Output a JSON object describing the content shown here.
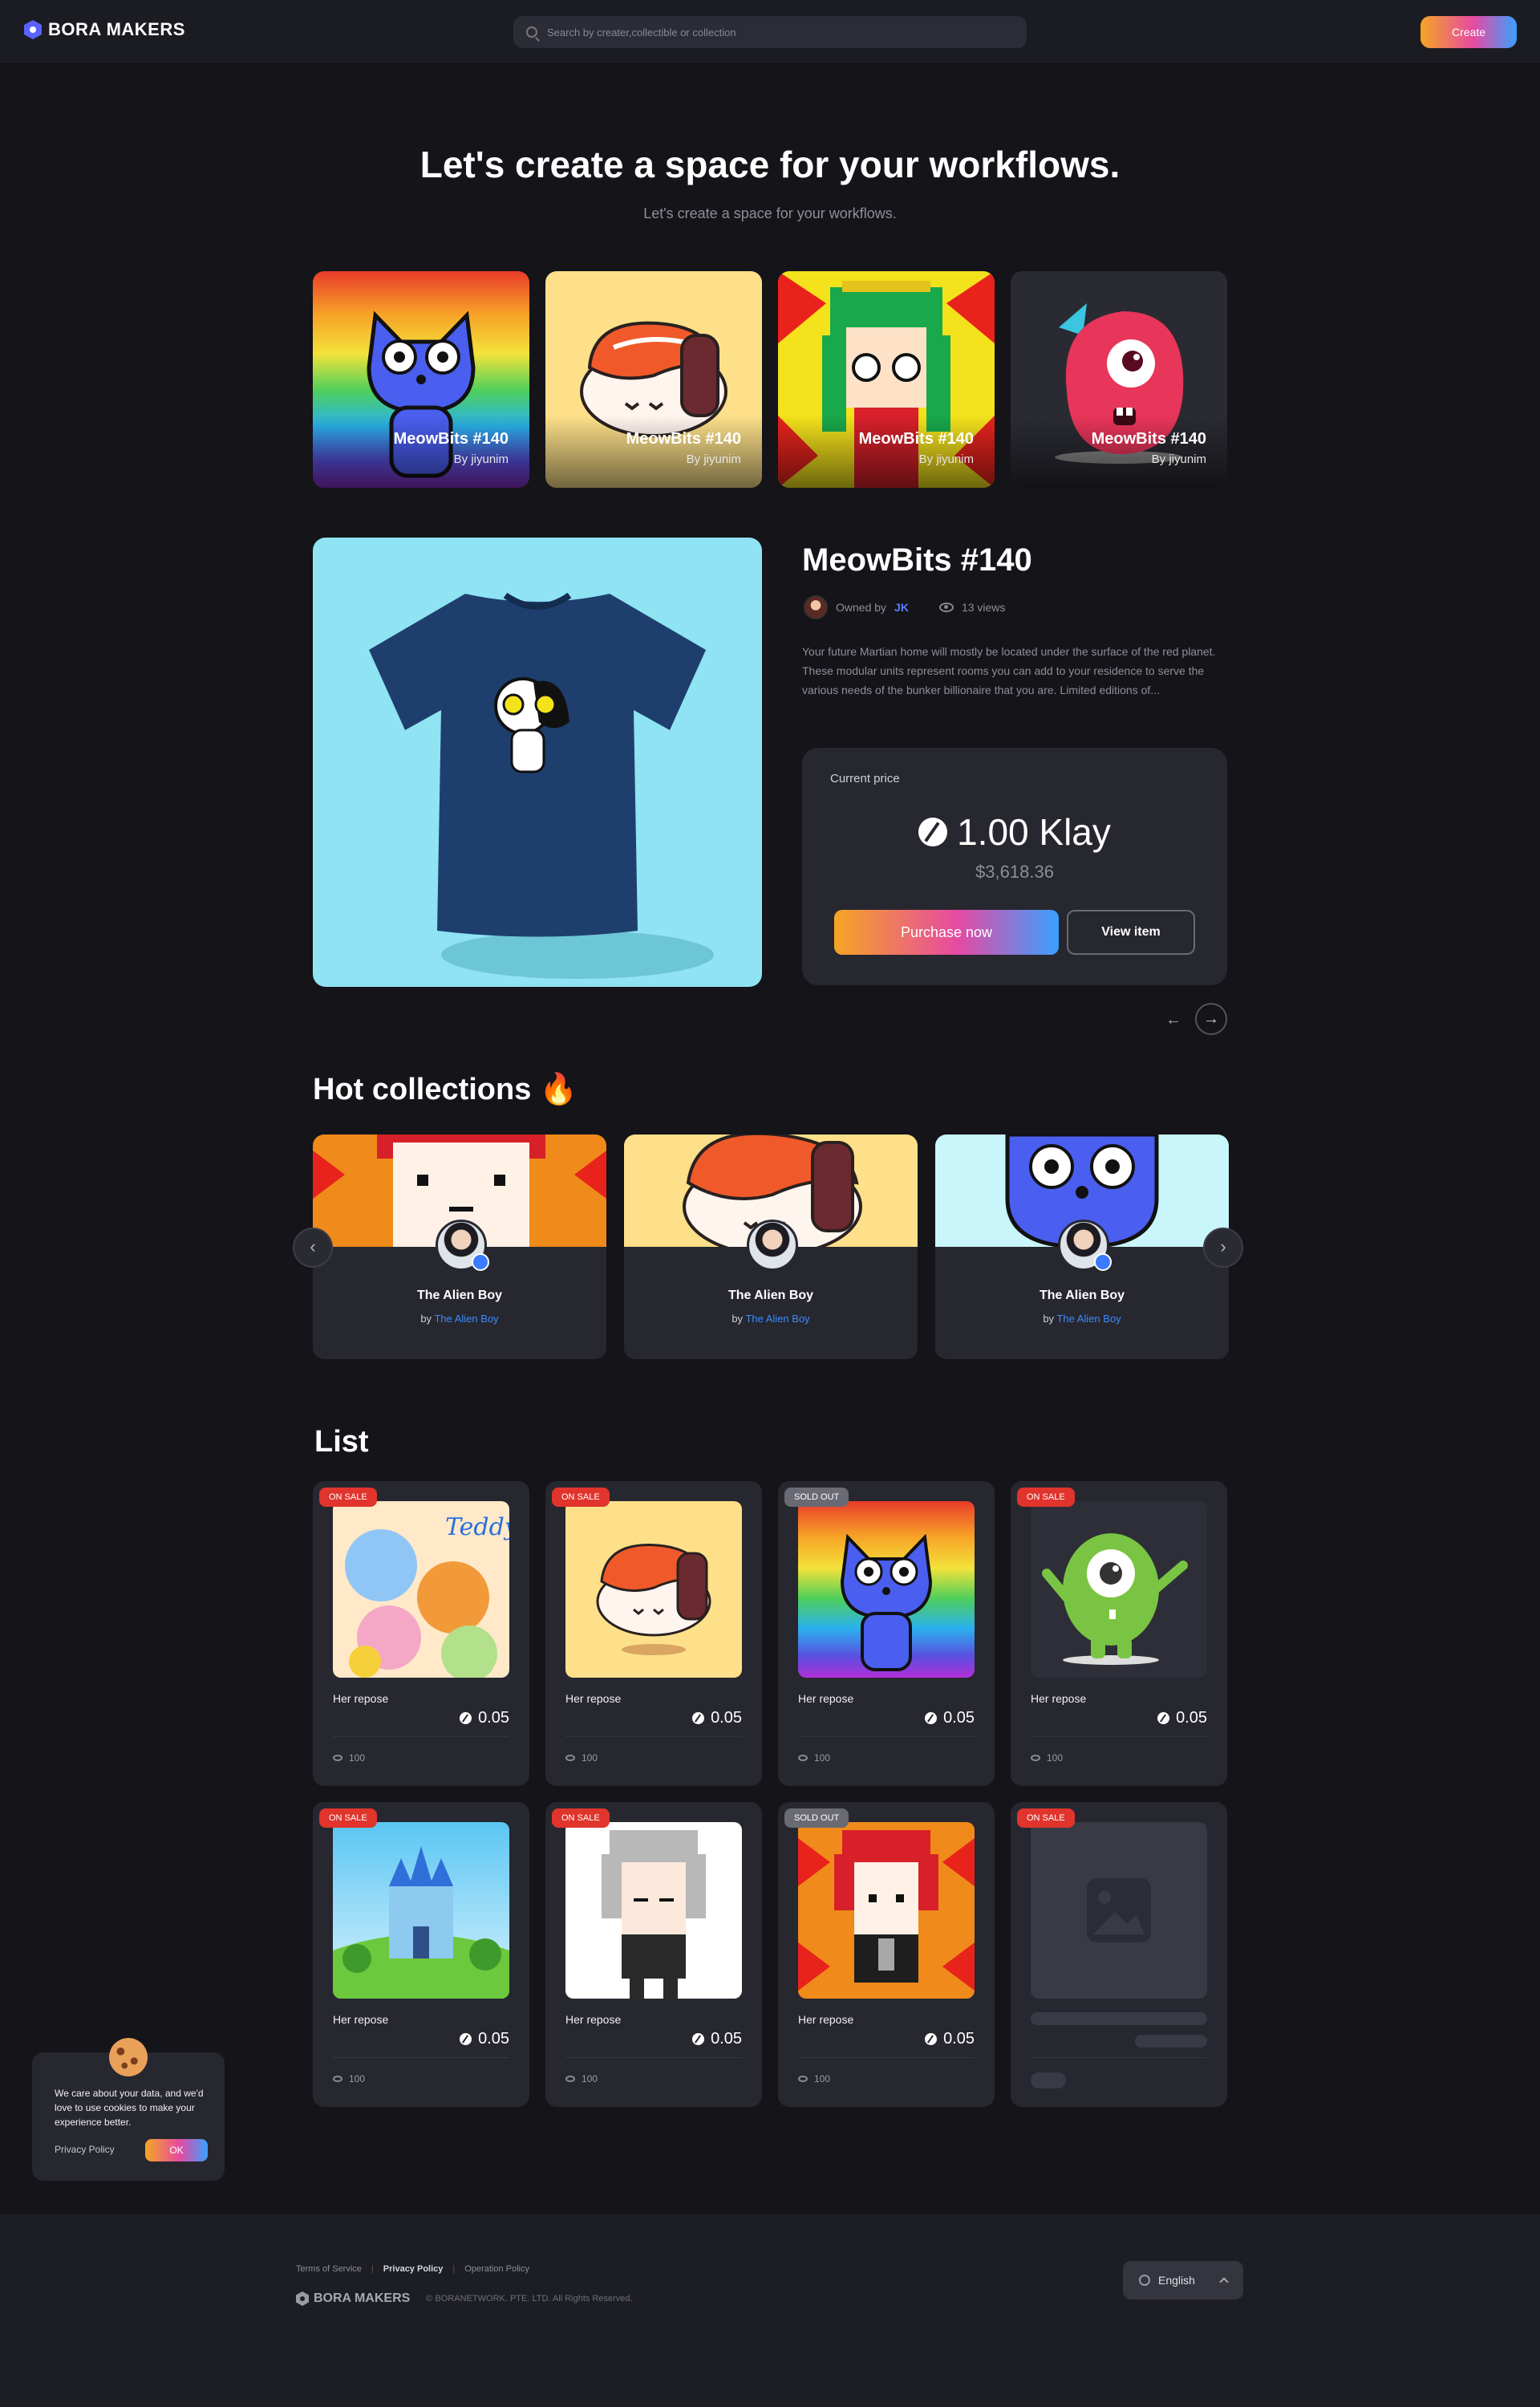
{
  "header": {
    "brand": "BORA MAKERS",
    "search_placeholder": "Search by creater,collectible or collection",
    "create_label": "Create"
  },
  "hero": {
    "title": "Let's create a space for your workflows.",
    "subtitle": "Let's create a space for your workflows."
  },
  "top_items": [
    {
      "title": "MeowBits #140",
      "by": "By jiyunim"
    },
    {
      "title": "MeowBits #140",
      "by": "By jiyunim"
    },
    {
      "title": "MeowBits #140",
      "by": "By jiyunim"
    },
    {
      "title": "MeowBits #140",
      "by": "By jiyunim"
    }
  ],
  "featured": {
    "title": "MeowBits #140",
    "owned_by_label": "Owned by",
    "owner": "JK",
    "views": "13 views",
    "description": "Your future Martian home will mostly be located under the surface of the red planet. These modular units represent rooms you can add to your residence to serve the various needs of the bunker billionaire that you are. Limited editions of...",
    "price_label": "Current price",
    "price": "1.00 Klay",
    "price_usd": "$3,618.36",
    "purchase_label": "Purchase now",
    "view_label": "View item",
    "prev_arrow": "←",
    "next_arrow": "→"
  },
  "hot": {
    "title": "Hot collections 🔥",
    "prev": "‹",
    "next": "›",
    "cards": [
      {
        "name": "The Alien Boy",
        "by_label": "by",
        "by": "The Alien Boy"
      },
      {
        "name": "The Alien Boy",
        "by_label": "by",
        "by": "The Alien Boy"
      },
      {
        "name": "The Alien Boy",
        "by_label": "by",
        "by": "The Alien Boy"
      }
    ]
  },
  "list": {
    "title": "List",
    "items": [
      {
        "badge": "ON SALE",
        "name": "Her repose",
        "price": "0.05",
        "views": "100"
      },
      {
        "badge": "ON SALE",
        "name": "Her repose",
        "price": "0.05",
        "views": "100"
      },
      {
        "badge": "SOLD OUT",
        "name": "Her repose",
        "price": "0.05",
        "views": "100"
      },
      {
        "badge": "ON SALE",
        "name": "Her repose",
        "price": "0.05",
        "views": "100"
      },
      {
        "badge": "ON SALE",
        "name": "Her repose",
        "price": "0.05",
        "views": "100"
      },
      {
        "badge": "ON SALE",
        "name": "Her repose",
        "price": "0.05",
        "views": "100"
      },
      {
        "badge": "SOLD OUT",
        "name": "Her repose",
        "price": "0.05",
        "views": "100"
      },
      {
        "badge": "ON SALE"
      }
    ]
  },
  "cookie": {
    "text": "We care about your data, and we'd love to use cookies to make your experience better.",
    "policy_label": "Privacy Policy",
    "ok_label": "OK"
  },
  "footer": {
    "links": [
      "Terms of Service",
      "Privacy Policy",
      "Operation Policy"
    ],
    "brand": "BORA MAKERS",
    "copyright": "© BORANETWORK. PTE. LTD. All Rights Reserved.",
    "language": "English"
  },
  "colors": {
    "background": "#141419",
    "card": "#272730",
    "accent_link": "#3a8bff",
    "sale_badge": "#e0342c",
    "sold_badge": "#6a6a74"
  }
}
